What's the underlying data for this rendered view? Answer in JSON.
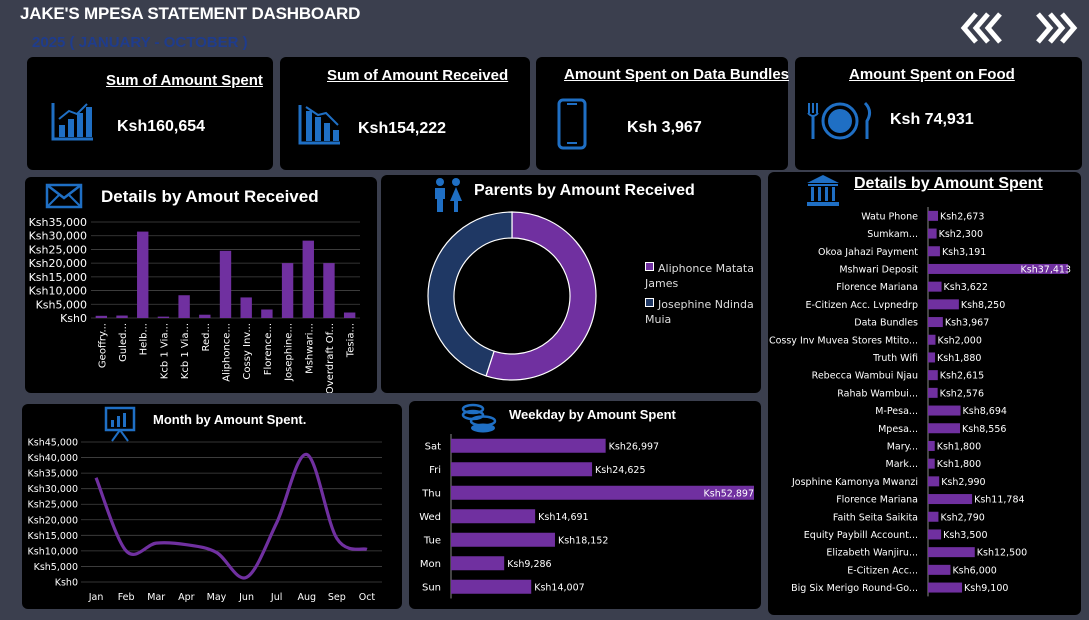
{
  "header": {
    "title": "JAKE'S MPESA STATEMENT DASHBOARD",
    "subtitle": "2025 ( JANUARY - OCTOBER )",
    "prev_label": "«",
    "next_label": "»"
  },
  "colors": {
    "bar": "#7030a0",
    "navy": "#1f3864",
    "icon": "#1f6fc4",
    "card": "#000000",
    "background": "#3b3f4e"
  },
  "kpis": [
    {
      "title": "Sum of Amount Spent",
      "value": "Ksh160,654",
      "icon": "chart-up-icon"
    },
    {
      "title": "Sum of Amount Received",
      "value": "Ksh154,222",
      "icon": "chart-down-icon"
    },
    {
      "title": "Amount Spent on Data Bundles",
      "value": "Ksh 3,967",
      "icon": "mobile-phone-icon"
    },
    {
      "title": "Amount Spent on Food",
      "value": "Ksh 74,931",
      "icon": "plate-cutlery-icon"
    }
  ],
  "panels": {
    "received": {
      "title": "Details by Amout Received",
      "icon": "envelope-icon"
    },
    "parents": {
      "title": "Parents by Amount Received",
      "icon": "parents-icon"
    },
    "spent": {
      "title": "Details by Amount Spent",
      "icon": "bank-icon"
    },
    "month": {
      "title": "Month by Amount Spent.",
      "icon": "presentation-icon"
    },
    "weekday": {
      "title": "Weekday by Amount Spent",
      "icon": "coins-icon"
    }
  },
  "chart_data": [
    {
      "id": "received",
      "type": "bar",
      "title": "Details by Amout Received",
      "categories": [
        "Geoffry...",
        "Guled...",
        "Helb...",
        "Kcb 1 Via...",
        "Kcb 1 Via...",
        "Red...",
        "Aliphonce...",
        "Cossy Inv...",
        "Florence...",
        "Josephine...",
        "Mshwari...",
        "Overdraft Of...",
        "Tesia..."
      ],
      "values": [
        800,
        900,
        31500,
        500,
        8300,
        1200,
        24500,
        7500,
        3100,
        20000,
        28200,
        20000,
        2000
      ],
      "yticks": [
        "Ksh0",
        "Ksh5,000",
        "Ksh10,000",
        "Ksh15,000",
        "Ksh20,000",
        "Ksh25,000",
        "Ksh30,000",
        "Ksh35,000"
      ],
      "ylim": [
        0,
        35000
      ],
      "grid": true
    },
    {
      "id": "parents",
      "type": "pie",
      "title": "Parents by Amount Received",
      "donut": true,
      "labels": [
        "Aliphonce Matata James",
        "Josephine Ndinda Muia"
      ],
      "values": [
        55,
        45
      ],
      "colors": [
        "#7030a0",
        "#1f3864"
      ],
      "legend": "right"
    },
    {
      "id": "spent",
      "type": "bar",
      "orientation": "horizontal",
      "title": "Details by Amount Spent",
      "categories": [
        "Watu Phone",
        "Sumkam...",
        "Okoa Jahazi Payment",
        "Mshwari Deposit",
        "Florence Mariana",
        "E-Citizen Acc. Lvpnedrp",
        "Data Bundles",
        "Cossy Inv Muvea Stores Mtito...",
        "Truth Wifi",
        "Rebecca Wambui Njau",
        "Rahab Wambui...",
        "M-Pesa...",
        "Mpesa...",
        "Mary...",
        "Mark...",
        "Josphine Kamonya Mwanzi",
        "Florence Mariana",
        "Faith Seita Saikita",
        "Equity Paybill Account...",
        "Elizabeth Wanjiru...",
        "E-Citizen Acc...",
        "Big Six Merigo Round-Go..."
      ],
      "values": [
        2673,
        2300,
        3191,
        37413,
        3622,
        8250,
        3967,
        2000,
        1880,
        2615,
        2576,
        8694,
        8556,
        1800,
        1800,
        2990,
        11784,
        2790,
        3500,
        12500,
        6000,
        9100
      ],
      "data_labels": [
        "Ksh2,673",
        "Ksh2,300",
        "Ksh3,191",
        "Ksh37,413",
        "Ksh3,622",
        "Ksh8,250",
        "Ksh3,967",
        "Ksh2,000",
        "Ksh1,880",
        "Ksh2,615",
        "Ksh2,576",
        "Ksh8,694",
        "Ksh8,556",
        "Ksh1,800",
        "Ksh1,800",
        "Ksh2,990",
        "Ksh11,784",
        "Ksh2,790",
        "Ksh3,500",
        "Ksh12,500",
        "Ksh6,000",
        "Ksh9,100"
      ]
    },
    {
      "id": "month",
      "type": "line",
      "title": "Month by Amount Spent.",
      "categories": [
        "Jan",
        "Feb",
        "Mar",
        "Apr",
        "May",
        "Jun",
        "Jul",
        "Aug",
        "Sep",
        "Oct"
      ],
      "values": [
        33500,
        10000,
        12500,
        12000,
        9500,
        1500,
        19000,
        41000,
        14000,
        10500
      ],
      "yticks": [
        "Ksh0",
        "Ksh5,000",
        "Ksh10,000",
        "Ksh15,000",
        "Ksh20,000",
        "Ksh25,000",
        "Ksh30,000",
        "Ksh35,000",
        "Ksh40,000",
        "Ksh45,000"
      ],
      "ylim": [
        0,
        45000
      ],
      "grid": true,
      "smooth": true
    },
    {
      "id": "weekday",
      "type": "bar",
      "orientation": "horizontal",
      "title": "Weekday by Amount Spent",
      "categories": [
        "Sat",
        "Fri",
        "Thu",
        "Wed",
        "Tue",
        "Mon",
        "Sun"
      ],
      "values": [
        26997,
        24625,
        52897,
        14691,
        18152,
        9286,
        14007
      ],
      "data_labels": [
        "Ksh26,997",
        "Ksh24,625",
        "Ksh52,897",
        "Ksh14,691",
        "Ksh18,152",
        "Ksh9,286",
        "Ksh14,007"
      ]
    }
  ]
}
